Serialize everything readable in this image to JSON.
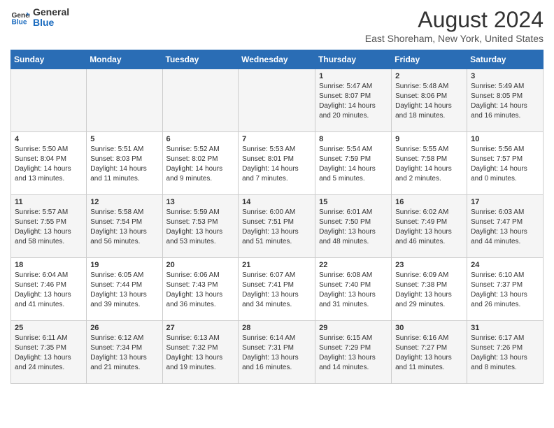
{
  "header": {
    "logo_general": "General",
    "logo_blue": "Blue",
    "title": "August 2024",
    "subtitle": "East Shoreham, New York, United States"
  },
  "days_of_week": [
    "Sunday",
    "Monday",
    "Tuesday",
    "Wednesday",
    "Thursday",
    "Friday",
    "Saturday"
  ],
  "weeks": [
    [
      {
        "day": "",
        "info": ""
      },
      {
        "day": "",
        "info": ""
      },
      {
        "day": "",
        "info": ""
      },
      {
        "day": "",
        "info": ""
      },
      {
        "day": "1",
        "info": "Sunrise: 5:47 AM\nSunset: 8:07 PM\nDaylight: 14 hours\nand 20 minutes."
      },
      {
        "day": "2",
        "info": "Sunrise: 5:48 AM\nSunset: 8:06 PM\nDaylight: 14 hours\nand 18 minutes."
      },
      {
        "day": "3",
        "info": "Sunrise: 5:49 AM\nSunset: 8:05 PM\nDaylight: 14 hours\nand 16 minutes."
      }
    ],
    [
      {
        "day": "4",
        "info": "Sunrise: 5:50 AM\nSunset: 8:04 PM\nDaylight: 14 hours\nand 13 minutes."
      },
      {
        "day": "5",
        "info": "Sunrise: 5:51 AM\nSunset: 8:03 PM\nDaylight: 14 hours\nand 11 minutes."
      },
      {
        "day": "6",
        "info": "Sunrise: 5:52 AM\nSunset: 8:02 PM\nDaylight: 14 hours\nand 9 minutes."
      },
      {
        "day": "7",
        "info": "Sunrise: 5:53 AM\nSunset: 8:01 PM\nDaylight: 14 hours\nand 7 minutes."
      },
      {
        "day": "8",
        "info": "Sunrise: 5:54 AM\nSunset: 7:59 PM\nDaylight: 14 hours\nand 5 minutes."
      },
      {
        "day": "9",
        "info": "Sunrise: 5:55 AM\nSunset: 7:58 PM\nDaylight: 14 hours\nand 2 minutes."
      },
      {
        "day": "10",
        "info": "Sunrise: 5:56 AM\nSunset: 7:57 PM\nDaylight: 14 hours\nand 0 minutes."
      }
    ],
    [
      {
        "day": "11",
        "info": "Sunrise: 5:57 AM\nSunset: 7:55 PM\nDaylight: 13 hours\nand 58 minutes."
      },
      {
        "day": "12",
        "info": "Sunrise: 5:58 AM\nSunset: 7:54 PM\nDaylight: 13 hours\nand 56 minutes."
      },
      {
        "day": "13",
        "info": "Sunrise: 5:59 AM\nSunset: 7:53 PM\nDaylight: 13 hours\nand 53 minutes."
      },
      {
        "day": "14",
        "info": "Sunrise: 6:00 AM\nSunset: 7:51 PM\nDaylight: 13 hours\nand 51 minutes."
      },
      {
        "day": "15",
        "info": "Sunrise: 6:01 AM\nSunset: 7:50 PM\nDaylight: 13 hours\nand 48 minutes."
      },
      {
        "day": "16",
        "info": "Sunrise: 6:02 AM\nSunset: 7:49 PM\nDaylight: 13 hours\nand 46 minutes."
      },
      {
        "day": "17",
        "info": "Sunrise: 6:03 AM\nSunset: 7:47 PM\nDaylight: 13 hours\nand 44 minutes."
      }
    ],
    [
      {
        "day": "18",
        "info": "Sunrise: 6:04 AM\nSunset: 7:46 PM\nDaylight: 13 hours\nand 41 minutes."
      },
      {
        "day": "19",
        "info": "Sunrise: 6:05 AM\nSunset: 7:44 PM\nDaylight: 13 hours\nand 39 minutes."
      },
      {
        "day": "20",
        "info": "Sunrise: 6:06 AM\nSunset: 7:43 PM\nDaylight: 13 hours\nand 36 minutes."
      },
      {
        "day": "21",
        "info": "Sunrise: 6:07 AM\nSunset: 7:41 PM\nDaylight: 13 hours\nand 34 minutes."
      },
      {
        "day": "22",
        "info": "Sunrise: 6:08 AM\nSunset: 7:40 PM\nDaylight: 13 hours\nand 31 minutes."
      },
      {
        "day": "23",
        "info": "Sunrise: 6:09 AM\nSunset: 7:38 PM\nDaylight: 13 hours\nand 29 minutes."
      },
      {
        "day": "24",
        "info": "Sunrise: 6:10 AM\nSunset: 7:37 PM\nDaylight: 13 hours\nand 26 minutes."
      }
    ],
    [
      {
        "day": "25",
        "info": "Sunrise: 6:11 AM\nSunset: 7:35 PM\nDaylight: 13 hours\nand 24 minutes."
      },
      {
        "day": "26",
        "info": "Sunrise: 6:12 AM\nSunset: 7:34 PM\nDaylight: 13 hours\nand 21 minutes."
      },
      {
        "day": "27",
        "info": "Sunrise: 6:13 AM\nSunset: 7:32 PM\nDaylight: 13 hours\nand 19 minutes."
      },
      {
        "day": "28",
        "info": "Sunrise: 6:14 AM\nSunset: 7:31 PM\nDaylight: 13 hours\nand 16 minutes."
      },
      {
        "day": "29",
        "info": "Sunrise: 6:15 AM\nSunset: 7:29 PM\nDaylight: 13 hours\nand 14 minutes."
      },
      {
        "day": "30",
        "info": "Sunrise: 6:16 AM\nSunset: 7:27 PM\nDaylight: 13 hours\nand 11 minutes."
      },
      {
        "day": "31",
        "info": "Sunrise: 6:17 AM\nSunset: 7:26 PM\nDaylight: 13 hours\nand 8 minutes."
      }
    ]
  ]
}
